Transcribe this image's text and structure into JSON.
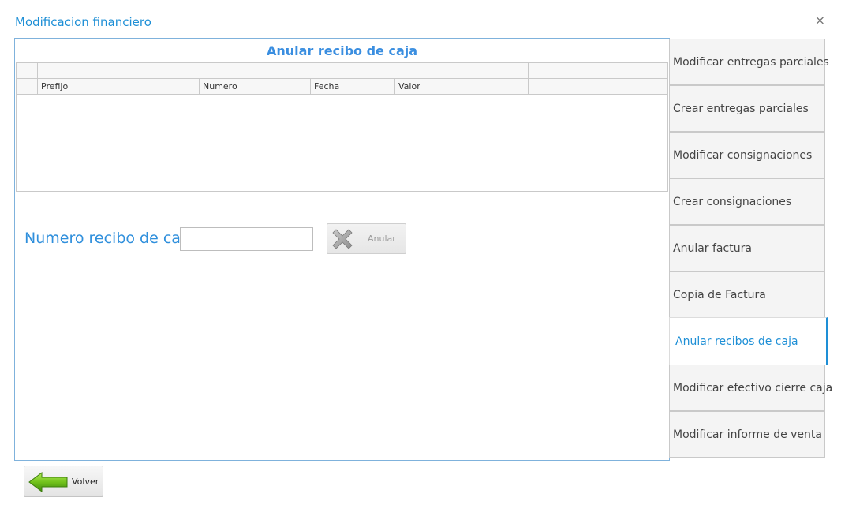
{
  "window": {
    "title": "Modificacion financiero",
    "close_glyph": "×"
  },
  "panel": {
    "title": "Anular recibo de caja",
    "grid": {
      "columns": [
        "Prefijo",
        "Numero",
        "Fecha",
        "Valor"
      ],
      "rows": []
    },
    "field_label": "Numero recibo de caja",
    "field_value": "",
    "anular_label": "Anular",
    "anular_icon": "x-cancel-icon"
  },
  "sidebar": {
    "items": [
      {
        "label": "Modificar entregas parciales",
        "active": false
      },
      {
        "label": "Crear entregas parciales",
        "active": false
      },
      {
        "label": "Modificar consignaciones",
        "active": false
      },
      {
        "label": "Crear consignaciones",
        "active": false
      },
      {
        "label": "Anular factura",
        "active": false
      },
      {
        "label": "Copia de Factura",
        "active": false
      },
      {
        "label": "Anular recibos de caja",
        "active": true
      },
      {
        "label": "Modificar efectivo cierre caja",
        "active": false
      },
      {
        "label": "Modificar informe de venta",
        "active": false
      }
    ]
  },
  "footer": {
    "volver_label": "Volver",
    "volver_icon": "green-left-arrow-icon"
  },
  "colors": {
    "accent": "#1e8fd6",
    "panel_border": "#7fb2dc",
    "title_blue": "#3a8ee0"
  }
}
